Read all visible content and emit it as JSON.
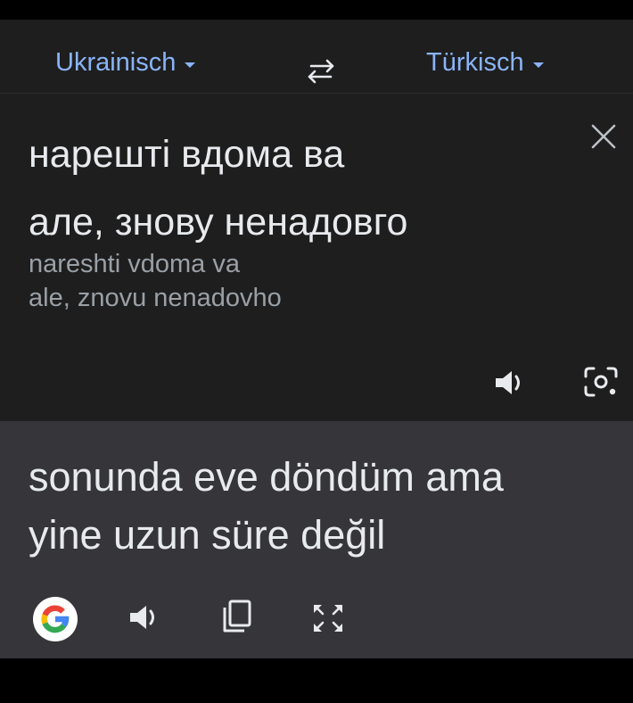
{
  "language_bar": {
    "source_language": "Ukrainisch",
    "target_language": "Türkisch",
    "swap_icon": "swap-arrows-icon"
  },
  "source": {
    "lines": [
      "нарешті вдома ва",
      "але, знову ненадовго"
    ],
    "transliteration_lines": [
      "nareshti vdoma va",
      "ale, znovu nenadovho"
    ],
    "icons": [
      "close-icon",
      "speaker-icon",
      "lens-icon"
    ]
  },
  "translation": {
    "lines": [
      "sonunda eve döndüm ama",
      "yine uzun süre değil"
    ],
    "icons": [
      "google-logo-icon",
      "speaker-icon",
      "copy-icon",
      "fullscreen-icon"
    ]
  },
  "colors": {
    "accent": "#8ab4f8",
    "panel": "#1e1e1e",
    "result_panel": "#36363a",
    "text": "#e8eaed",
    "secondary_text": "#9aa0a6"
  }
}
